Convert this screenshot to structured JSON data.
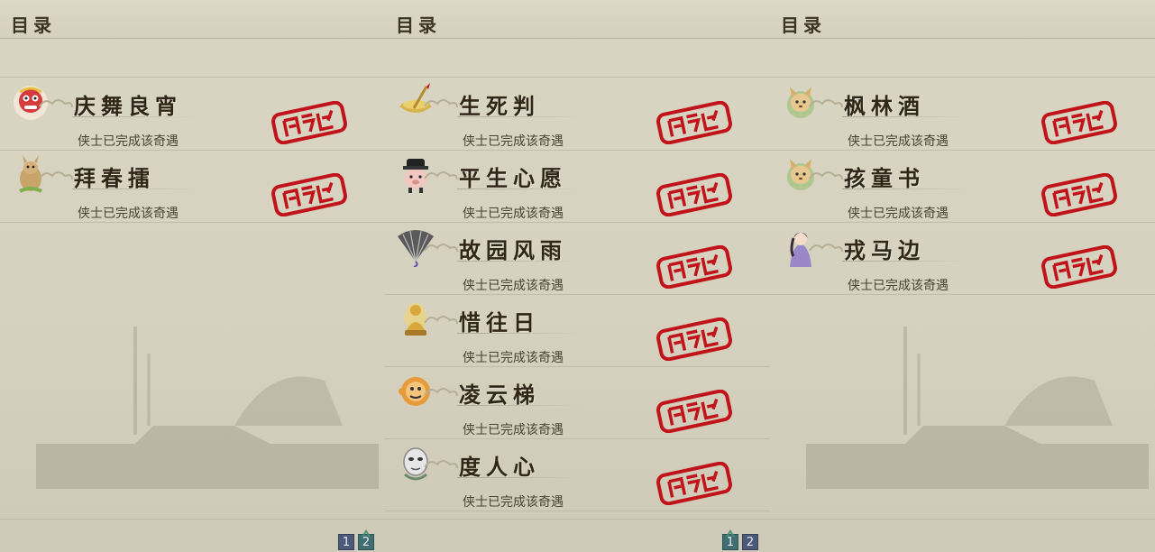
{
  "panels": [
    {
      "title": "目录",
      "entries": [
        {
          "name": "庆舞良宵",
          "status": "侠士已完成该奇遇",
          "icon": "lion-dance-icon"
        },
        {
          "name": "拜春擂",
          "status": "侠士已完成该奇遇",
          "icon": "kangaroo-icon"
        }
      ],
      "pager": {
        "pages": [
          "1",
          "2"
        ],
        "active": "2"
      }
    },
    {
      "title": "目录",
      "entries": [
        {
          "name": "生死判",
          "status": "侠士已完成该奇遇",
          "icon": "judge-pen-icon"
        },
        {
          "name": "平生心愿",
          "status": "侠士已完成该奇遇",
          "icon": "scholar-pig-icon"
        },
        {
          "name": "故园风雨",
          "status": "侠士已完成该奇遇",
          "icon": "fan-icon"
        },
        {
          "name": "惜往日",
          "status": "侠士已完成该奇遇",
          "icon": "buddha-icon"
        },
        {
          "name": "凌云梯",
          "status": "侠士已完成该奇遇",
          "icon": "monkey-face-icon"
        },
        {
          "name": "度人心",
          "status": "侠士已完成该奇遇",
          "icon": "mask-icon"
        }
      ],
      "pager": {
        "pages": [
          "1",
          "2"
        ],
        "active": "1"
      }
    },
    {
      "title": "目录",
      "entries": [
        {
          "name": "枫林酒",
          "status": "侠士已完成该奇遇",
          "icon": "fox-icon"
        },
        {
          "name": "孩童书",
          "status": "侠士已完成该奇遇",
          "icon": "fox-icon"
        },
        {
          "name": "戎马边",
          "status": "侠士已完成该奇遇",
          "icon": "heroine-portrait-icon"
        }
      ],
      "pager": {
        "pages": [],
        "active": ""
      }
    }
  ],
  "stamp_color": "#c0141a"
}
